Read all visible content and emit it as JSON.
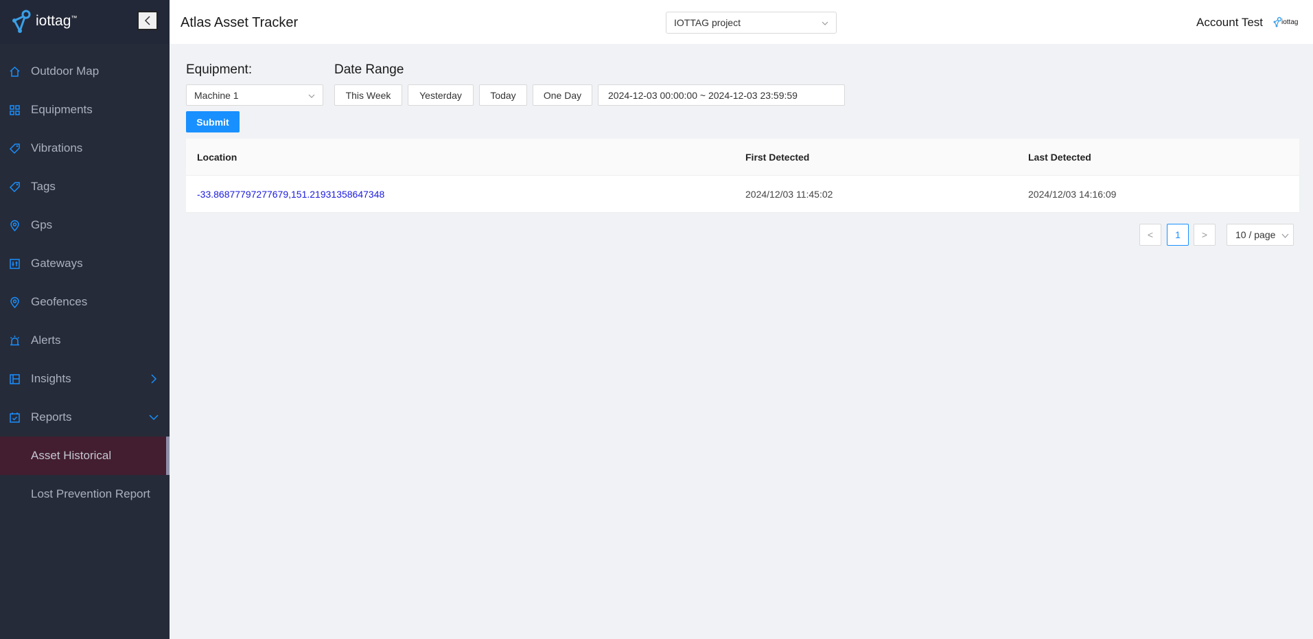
{
  "brand": {
    "name": "iottag",
    "tm": "™"
  },
  "header": {
    "title": "Atlas Asset Tracker",
    "project": "IOTTAG project",
    "account": "Account Test",
    "mini_logo": "iottag"
  },
  "sidebar": {
    "items": [
      {
        "label": "Outdoor Map",
        "icon": "home-icon"
      },
      {
        "label": "Equipments",
        "icon": "grid-icon"
      },
      {
        "label": "Vibrations",
        "icon": "tag-icon"
      },
      {
        "label": "Tags",
        "icon": "tag-icon"
      },
      {
        "label": "Gps",
        "icon": "location-pin-icon"
      },
      {
        "label": "Gateways",
        "icon": "gateway-icon"
      },
      {
        "label": "Geofences",
        "icon": "location-pin-icon"
      },
      {
        "label": "Alerts",
        "icon": "alarm-icon"
      },
      {
        "label": "Insights",
        "icon": "insights-icon"
      },
      {
        "label": "Reports",
        "icon": "reports-icon"
      }
    ],
    "subitems": [
      {
        "label": "Asset Historical"
      },
      {
        "label": "Lost Prevention Report"
      }
    ]
  },
  "filters": {
    "equipment_label": "Equipment:",
    "equipment_value": "Machine 1",
    "range_label": "Date Range",
    "buttons": [
      "This Week",
      "Yesterday",
      "Today",
      "One Day"
    ],
    "date_range": "2024-12-03 00:00:00 ~ 2024-12-03 23:59:59",
    "submit": "Submit"
  },
  "table": {
    "columns": [
      "Location",
      "First Detected",
      "Last Detected"
    ],
    "rows": [
      [
        "-33.86877797277679,151.21931358647348",
        "2024/12/03 11:45:02",
        "2024/12/03 14:16:09"
      ]
    ]
  },
  "pagination": {
    "prev": "<",
    "current": "1",
    "next": ">",
    "page_size": "10 / page"
  },
  "colors": {
    "sidebar_bg": "#262b39",
    "accent": "#1890ff",
    "active_bg": "#431e30",
    "link": "#1a1adf"
  }
}
